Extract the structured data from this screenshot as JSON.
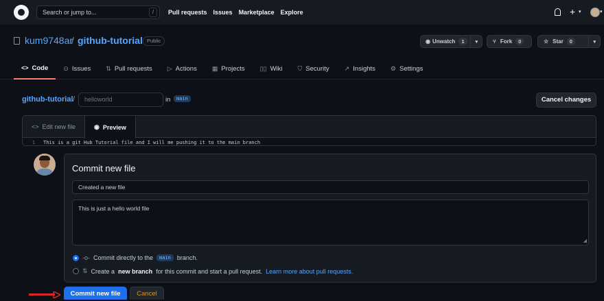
{
  "header": {
    "search_placeholder": "Search or jump to...",
    "search_shortcut": "/",
    "nav": [
      "Pull requests",
      "Issues",
      "Marketplace",
      "Explore"
    ],
    "plus": "+",
    "icons": [
      "github-logo-icon",
      "bell-icon",
      "plus-icon",
      "avatar-icon"
    ]
  },
  "repo": {
    "owner": "kum9748ar",
    "separator": "/",
    "name": "github-tutorial",
    "visibility": "Public",
    "unwatch_label": "Unwatch",
    "unwatch_count": "1",
    "fork_label": "Fork",
    "fork_count": "0",
    "star_label": "Star",
    "star_count": "0"
  },
  "tabs": [
    {
      "label": "Code",
      "icon": "<>",
      "active": true
    },
    {
      "label": "Issues",
      "icon": "⊙"
    },
    {
      "label": "Pull requests",
      "icon": "⇅"
    },
    {
      "label": "Actions",
      "icon": "▷"
    },
    {
      "label": "Projects",
      "icon": "▦"
    },
    {
      "label": "Wiki",
      "icon": "▯▯"
    },
    {
      "label": "Security",
      "icon": "⛉"
    },
    {
      "label": "Insights",
      "icon": "↗"
    },
    {
      "label": "Settings",
      "icon": "⚙"
    }
  ],
  "editor": {
    "repo_link": "github-tutorial",
    "separator": "/",
    "filename_placeholder": "helloworld",
    "in_label": "in",
    "branch": "main",
    "cancel_changes": "Cancel changes",
    "tab_edit": "Edit new file",
    "tab_preview": "Preview",
    "line_number": "1",
    "line_text": "This is a git Hub Tutorial file and I will me pushing it to the main branch"
  },
  "commit": {
    "title": "Commit new file",
    "summary_value": "Created a new file",
    "description_value": "This is just a hello world file",
    "option1_prefix": "Commit directly to the",
    "option1_branch": "main",
    "option1_suffix": "branch.",
    "option2_prefix": "Create a",
    "option2_bold": "new branch",
    "option2_suffix": "for this commit and start a pull request.",
    "option2_link": "Learn more about pull requests.",
    "commit_button": "Commit new file",
    "cancel_button": "Cancel"
  },
  "colors": {
    "accent": "#1f6feb",
    "link": "#58a6ff",
    "background": "#0d1117",
    "annotation_arrow": "#d92828"
  }
}
